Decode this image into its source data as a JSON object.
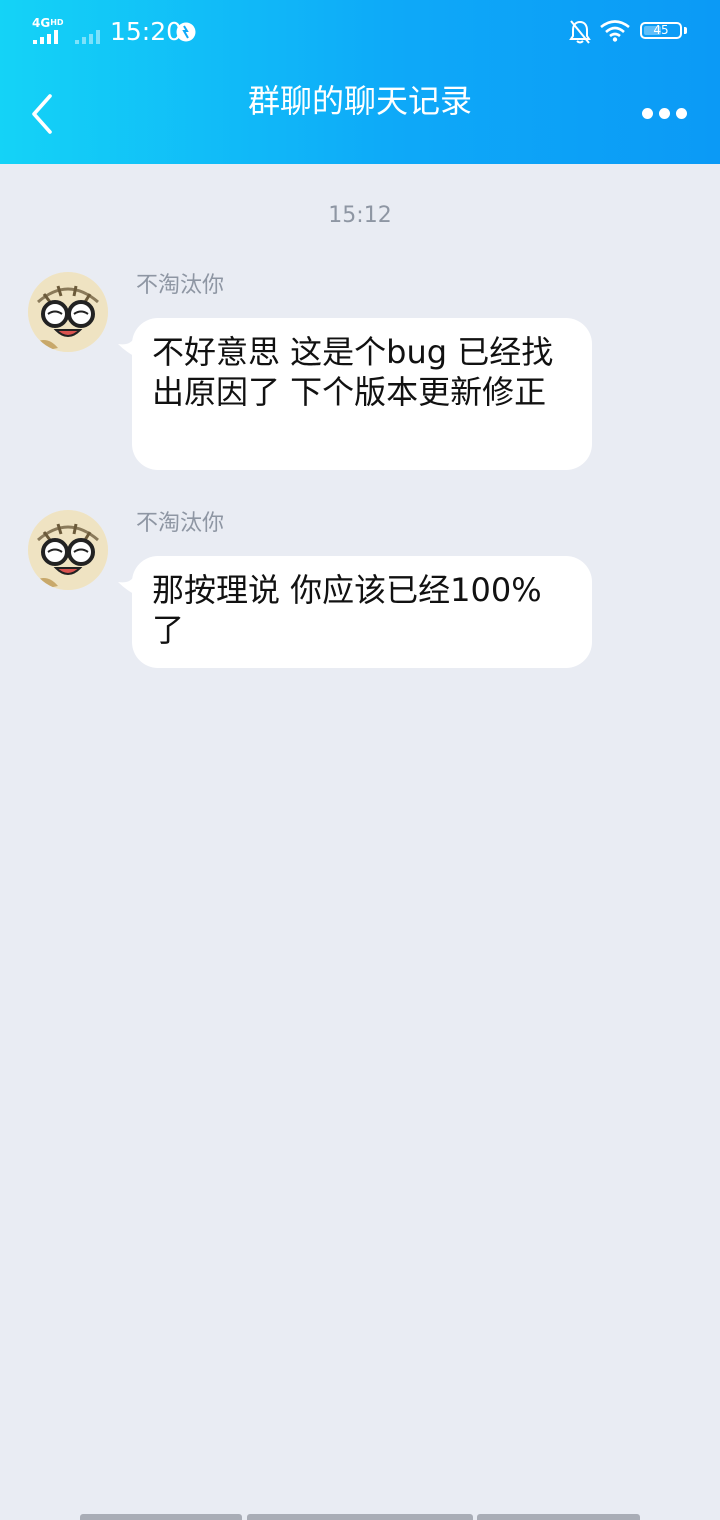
{
  "status_bar": {
    "network": "4G",
    "network_suffix": "HD",
    "time": "15:20",
    "battery": "45"
  },
  "header": {
    "title": "群聊的聊天记录"
  },
  "timestamp": "15:12",
  "messages": [
    {
      "sender": "不淘汰你",
      "text": "不好意思 这是个bug 已经找出原因了 下个版本更新修正"
    },
    {
      "sender": "不淘汰你",
      "text": "那按理说 你应该已经100%了"
    }
  ],
  "colors": {
    "header_start": "#14d3f7",
    "header_end": "#0b9af6",
    "background": "#e9ecf3",
    "secondary_text": "#8e96a3"
  }
}
